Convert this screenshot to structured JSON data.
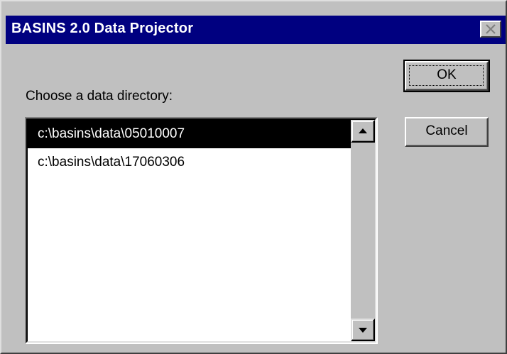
{
  "window": {
    "title": "BASINS 2.0 Data Projector"
  },
  "dialog": {
    "prompt": "Choose a data directory:",
    "directories": [
      {
        "path": "c:\\basins\\data\\05010007",
        "selected": true
      },
      {
        "path": "c:\\basins\\data\\17060306",
        "selected": false
      }
    ]
  },
  "buttons": {
    "ok_label": "OK",
    "cancel_label": "Cancel"
  },
  "icons": {
    "close": "close-icon",
    "scroll_up": "arrow-up-icon",
    "scroll_down": "arrow-down-icon"
  },
  "colors": {
    "title_bar": "#000080",
    "dialog_face": "#c0c0c0",
    "selection": "#000000"
  }
}
